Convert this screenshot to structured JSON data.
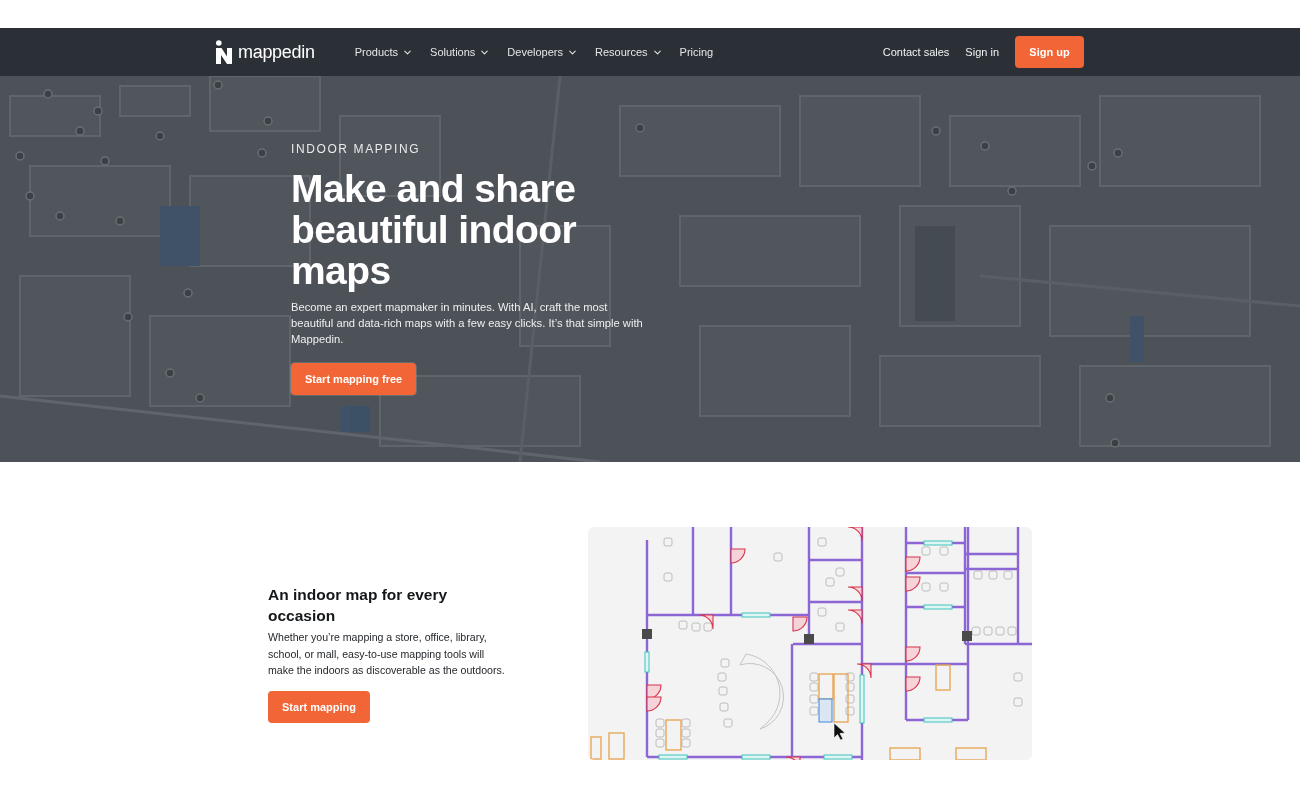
{
  "nav": {
    "logo": "mappedin",
    "items": [
      {
        "label": "Products",
        "dropdown": true
      },
      {
        "label": "Solutions",
        "dropdown": true
      },
      {
        "label": "Developers",
        "dropdown": true
      },
      {
        "label": "Resources",
        "dropdown": true
      },
      {
        "label": "Pricing",
        "dropdown": false
      }
    ],
    "actions": [
      {
        "label": "Contact sales",
        "kind": "link"
      },
      {
        "label": "Sign in",
        "kind": "link"
      },
      {
        "label": "Sign up",
        "kind": "button"
      }
    ]
  },
  "hero": {
    "eyebrow": "INDOOR MAPPING",
    "title_lines": [
      "Make and share",
      "beautiful indoor",
      "maps"
    ],
    "text": "Become an expert mapmaker in minutes. With AI, craft the most beautiful and data-rich maps with a few easy clicks. It’s that simple with Mappedin.",
    "button": "Start mapping free"
  },
  "feature": {
    "title": "An indoor map for every occasion",
    "text": "Whether you’re mapping a store, office, library, school, or mall, easy-to-use mapping tools will make the indoors as discoverable as the outdoors.",
    "button": "Start mapping"
  }
}
